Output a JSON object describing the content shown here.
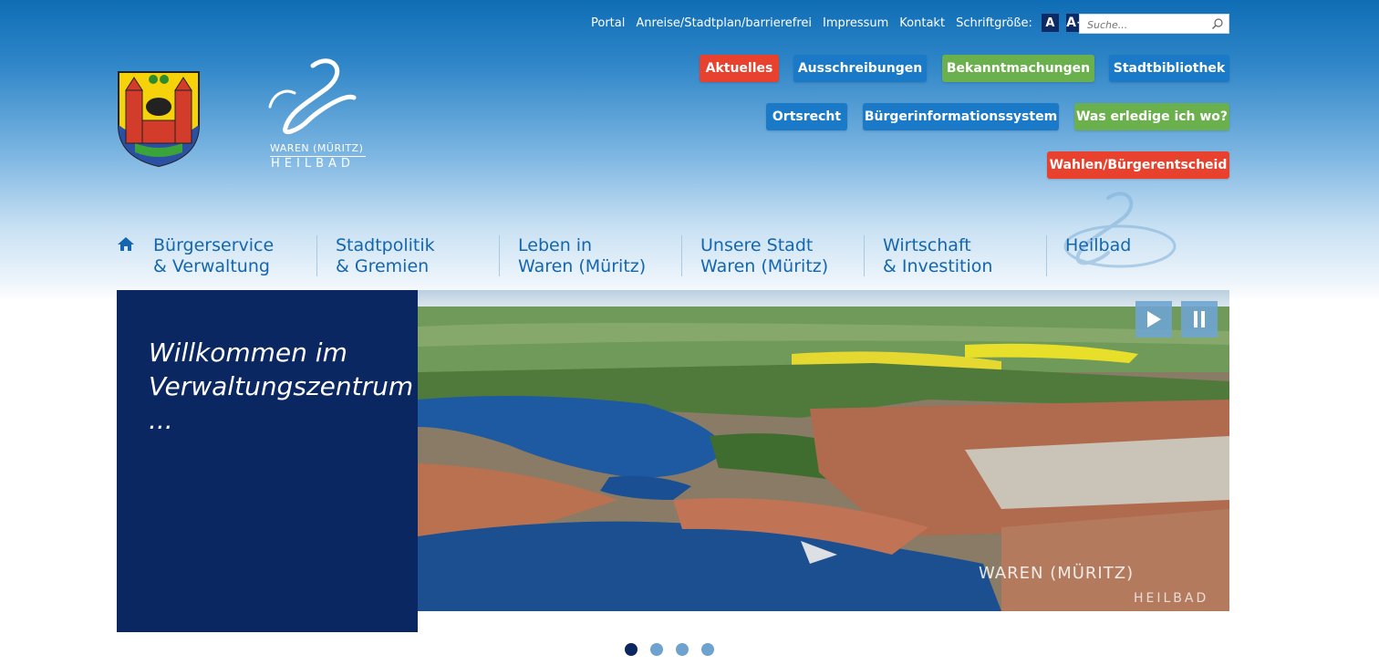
{
  "toplinks": [
    "Portal",
    "Anreise/Stadtplan/barrierefrei",
    "Impressum",
    "Kontakt"
  ],
  "fontsize": {
    "label": "Schriftgröße:",
    "small": "A",
    "large": "A+"
  },
  "search": {
    "placeholder": "Suche..."
  },
  "logo": {
    "line1": "WAREN (MÜRITZ)",
    "line2": "HEILBAD"
  },
  "buttons": {
    "aktuelles": "Aktuelles",
    "ausschreibungen": "Ausschreibungen",
    "bekanntmachungen": "Bekanntmachungen",
    "stadtbibliothek": "Stadtbibliothek",
    "ortsrecht": "Ortsrecht",
    "buergerinfo": "Bürgerinformationssystem",
    "erledige": "Was erledige ich wo?",
    "wahlen": "Wahlen/Bürgerentscheid"
  },
  "nav": [
    {
      "l1": "Bürgerservice",
      "l2": "& Verwaltung"
    },
    {
      "l1": "Stadtpolitik",
      "l2": "& Gremien"
    },
    {
      "l1": "Leben in",
      "l2": "Waren (Müritz)"
    },
    {
      "l1": "Unsere Stadt",
      "l2": "Waren (Müritz)"
    },
    {
      "l1": "Wirtschaft",
      "l2": "& Investition"
    },
    {
      "l1": "Heilbad",
      "l2": ""
    }
  ],
  "slider": {
    "welcome_line1": "Willkommen im",
    "welcome_line2": "Verwaltungszentrum",
    "welcome_line3": "...",
    "watermark": "WAREN (MÜRITZ)",
    "watermark2": "HEILBAD"
  },
  "colors": {
    "navy": "#0b2761",
    "red": "#e8412d",
    "blue": "#1a7ac7",
    "green": "#6ab04c"
  }
}
